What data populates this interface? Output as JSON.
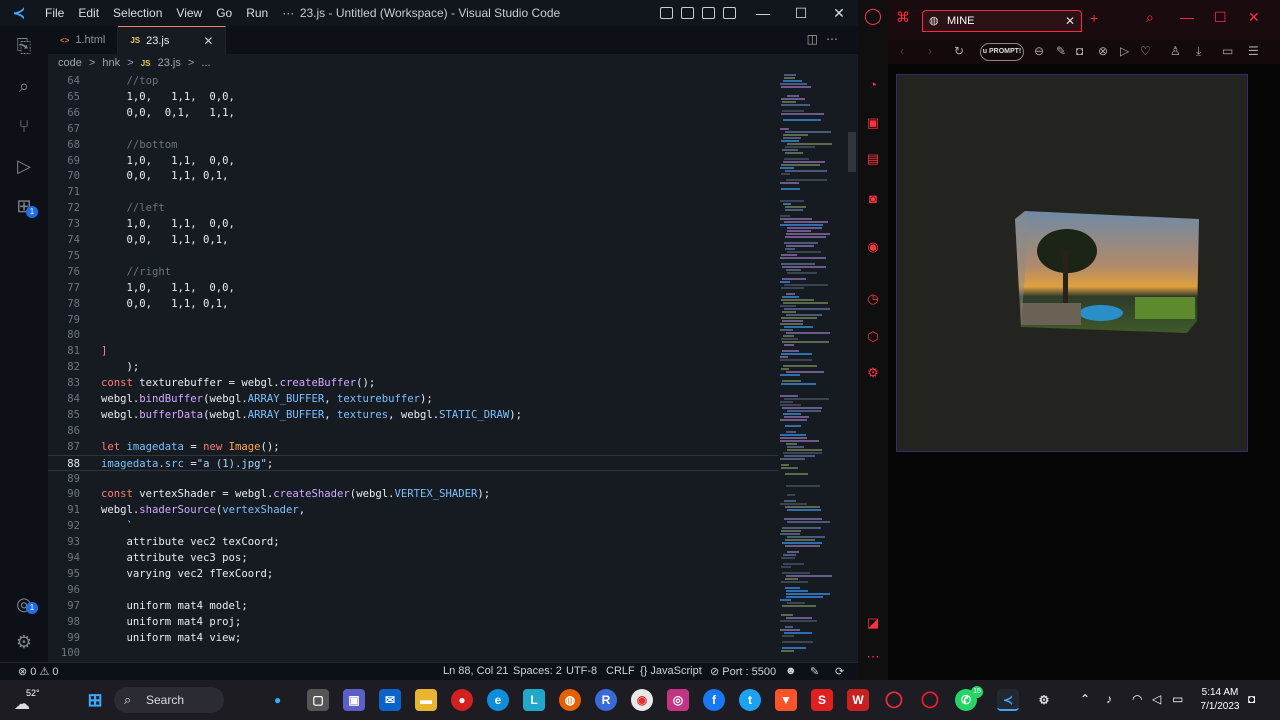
{
  "vscode": {
    "menu": [
      "File",
      "Edit",
      "Selection",
      "View",
      "Go",
      "Run",
      "···"
    ],
    "window_title": "23.js - Untitled (Workspace) - Visual Studio Code",
    "tabs": [
      {
        "label": "1.html",
        "icon": "html-icon",
        "active": false
      },
      {
        "label": "23.js",
        "icon": "JS",
        "active": true
      }
    ],
    "breadcrumb": [
      "code",
      ">",
      "hnk",
      ">",
      "JS",
      "23.js",
      ">",
      "..."
    ],
    "activity_badges": [
      "1",
      "1"
    ],
    "code_lines": [
      {
        "n": "64",
        "html": "    <span class='t-cm'>//top</span>"
      },
      {
        "n": "65",
        "html": "    1,0,   1,1,  0,0,"
      },
      {
        "n": "66",
        "html": "    0,0,  0,1,   1,1,"
      },
      {
        "n": "67",
        "html": ""
      },
      {
        "n": "68",
        "html": "    <span class='t-cm'>//bottom</span>"
      },
      {
        "n": "69",
        "html": "    1,0,   1,1,  0,0,"
      },
      {
        "n": "70",
        "html": "    0,0,   1,1, 0,1,"
      },
      {
        "n": "71",
        "html": ""
      },
      {
        "n": "72",
        "html": "    <span class='t-cm'>//left</span>"
      },
      {
        "n": "73",
        "html": "    1,0,   1,1,  0,0,"
      },
      {
        "n": "74",
        "html": "    0,0,   1,1, 0,1,"
      },
      {
        "n": "75",
        "html": ""
      },
      {
        "n": "76",
        "html": "    <span class='t-cm'>//right</span>"
      },
      {
        "n": "77",
        "html": "    1,0,   1,1,  0,0,"
      },
      {
        "n": "78",
        "html": "    0,0,   1,1, 0,1,"
      },
      {
        "n": "79",
        "html": ""
      },
      {
        "n": "80",
        "html": ""
      },
      {
        "n": "81",
        "html": "<span class='t-br'>]</span>"
      },
      {
        "n": "82",
        "html": "    );"
      },
      {
        "n": "83",
        "html": "<span class='t-kw'>const</span> <span class='t-id'>texturebuffer</span> = <span class='t-id'>webgl</span>.<span class='t-fn'>createBuffer</span>();"
      },
      {
        "n": "84",
        "html": "<span class='t-id'>webgl</span>.<span class='t-fn'>bindBuffer</span>(<span class='t-id'>webgl</span>.<span class='t-var'>ARRAY_BUFFER</span>, <span class='t-var'>texturebuffer</span>);"
      },
      {
        "n": "85",
        "html": "<span class='t-id'>webgl</span>.<span class='t-fn'>bufferData</span>(<span class='t-id'>webgl</span>.<span class='t-var'>ARRAY_BUFFER</span>, <span class='t-var'>textures</span>, <span class='t-id'>webgl</span>.<span class='t-var'>STATIC_DRAW</span>);"
      },
      {
        "n": "86",
        "html": ""
      },
      {
        "n": "87",
        "html": "<span class='t-kw'>let</span> <span class='t-var'>imagedata</span> = <span class='t-kw'>new</span> <span class='t-cls'>Image</span>();"
      },
      {
        "n": "88",
        "html": "<span class='t-var'>imagedata</span>.<span class='t-var'>src</span> =<span class='t-str'>\"a (1).jpg\"</span>;",
        "current": true
      },
      {
        "n": "89",
        "html": ""
      },
      {
        "n": "90",
        "html": "<span class='t-kw'>const</span> <span class='t-id'>vertexShader</span> = <span class='t-id'>webgl</span>.<span class='t-fn'>createShader</span>(<span class='t-id'>webgl</span>.<span class='t-var'>VERTEX_SHADER</span>);"
      },
      {
        "n": "91",
        "html": "<span class='t-id'>webgl</span>.<span class='t-fn'>shaderSource</span>(<span class='t-var'>vertexShader</span>,"
      },
      {
        "n": "92",
        "html": "    <span class='t-str'>`</span>"
      },
      {
        "n": "93",
        "html": "    attribute vec2 texCoord;"
      },
      {
        "n": "94",
        "html": "    attribute vec3 pos;"
      },
      {
        "n": "95",
        "html": "    varying vec2 fTexCoord;"
      },
      {
        "n": "96",
        "html": ""
      },
      {
        "n": "97",
        "html": "    uniform mat4 model;"
      },
      {
        "n": "98",
        "html": "    uniform mat4 proj;"
      },
      {
        "n": "99",
        "html": "    uniform mat4 view;"
      },
      {
        "n": "100",
        "html": ""
      }
    ],
    "status": {
      "problems": "⊗ 0 ⚠ 0",
      "position": "Ln 88, Col 21",
      "spaces": "Spaces: 2",
      "encoding": "UTF-8",
      "eol": "CRLF",
      "language": "{} JavaScript",
      "port": "⊘ Port : 5500"
    }
  },
  "browser": {
    "tab_title": "MINE",
    "address_text": "u PROMPT!"
  },
  "taskbar": {
    "temperature": "52°",
    "search_label": "Search",
    "whatsapp_badge": "15",
    "time": "5:14 AM",
    "date": "7/1/2023"
  }
}
